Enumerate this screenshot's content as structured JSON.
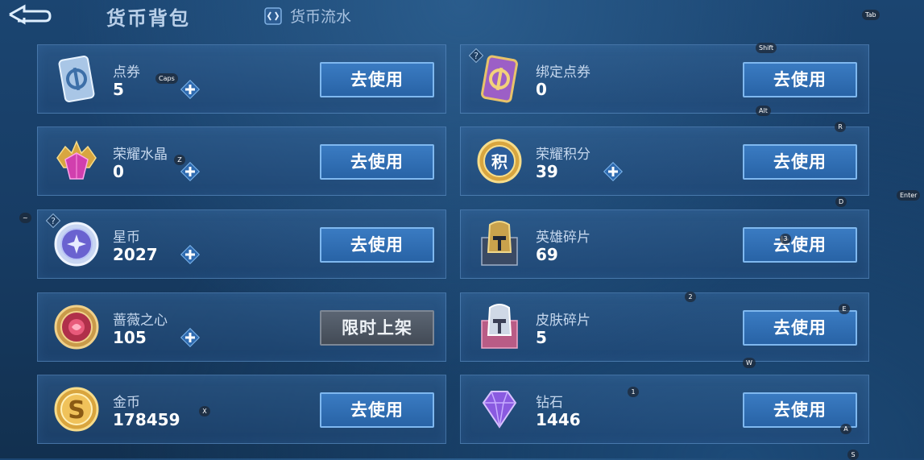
{
  "header": {
    "title": "货币背包",
    "flow_label": "货币流水"
  },
  "buttons": {
    "use_label": "去使用",
    "limited_label": "限时上架"
  },
  "currencies": [
    {
      "name": "点券",
      "amount": "5",
      "icon": "blue-voucher-card-icon"
    },
    {
      "name": "绑定点券",
      "amount": "0",
      "icon": "purple-voucher-card-icon"
    },
    {
      "name": "荣耀水晶",
      "amount": "0",
      "icon": "glory-crystal-icon"
    },
    {
      "name": "荣耀积分",
      "amount": "39",
      "icon": "glory-points-coin-icon"
    },
    {
      "name": "星币",
      "amount": "2027",
      "icon": "star-coin-icon"
    },
    {
      "name": "英雄碎片",
      "amount": "69",
      "icon": "hero-fragment-icon"
    },
    {
      "name": "蔷薇之心",
      "amount": "105",
      "icon": "rose-heart-icon"
    },
    {
      "name": "皮肤碎片",
      "amount": "5",
      "icon": "skin-fragment-icon"
    },
    {
      "name": "金币",
      "amount": "178459",
      "icon": "gold-coin-icon"
    },
    {
      "name": "钻石",
      "amount": "1446",
      "icon": "diamond-icon"
    }
  ],
  "key_hints": {
    "tab": "Tab",
    "shift": "Shift",
    "caps": "Caps",
    "alt": "Alt",
    "r": "R",
    "z": "Z",
    "enter": "Enter",
    "d": "D",
    "tilde": "~",
    "three": "3",
    "two": "2",
    "e": "E",
    "w": "W",
    "one": "1",
    "x": "X",
    "a": "A",
    "s": "S"
  },
  "colors": {
    "use_button": "#3270b6",
    "limited_button": "#4f5864",
    "card_border": "#6ea5dc"
  }
}
